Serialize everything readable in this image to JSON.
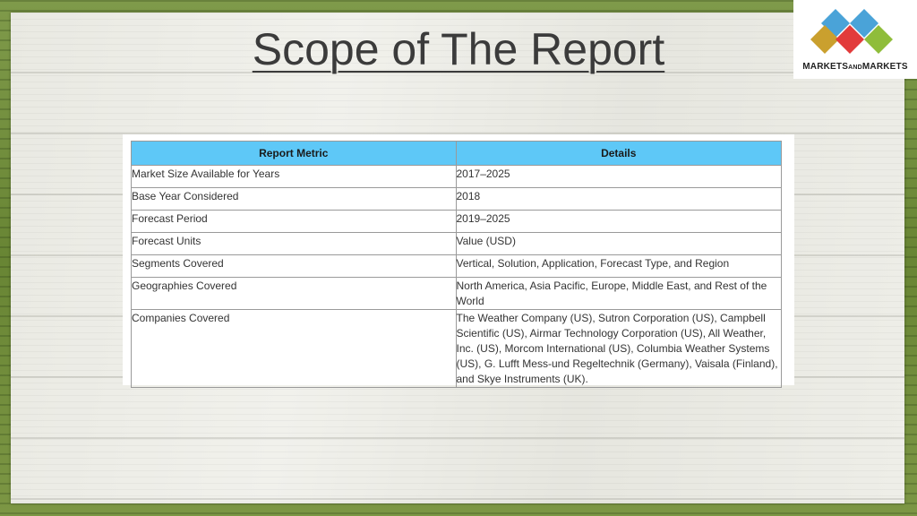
{
  "slide": {
    "title": "Scope of The Report"
  },
  "logo": {
    "text_part1": "MARKETS",
    "text_part2": "AND",
    "text_part3": "MARKETS",
    "colors": [
      "#4aa3d8",
      "#8fbd3a",
      "#e23b3b",
      "#caa02e"
    ]
  },
  "table": {
    "headers": [
      "Report Metric",
      "Details"
    ],
    "header_color": "#5ec8f7",
    "rows": [
      [
        "Market Size Available for Years",
        "2017–2025"
      ],
      [
        "Base Year Considered",
        "2018"
      ],
      [
        "Forecast Period",
        "2019–2025"
      ],
      [
        "Forecast Units",
        "Value (USD)"
      ],
      [
        "Segments Covered",
        "Vertical, Solution, Application, Forecast Type, and Region"
      ],
      [
        "Geographies Covered",
        "North America, Asia Pacific, Europe, Middle East, and Rest of the World"
      ],
      [
        "Companies Covered",
        "The Weather Company (US), Sutron Corporation (US), Campbell Scientific (US), Airmar Technology Corporation (US), All Weather, Inc. (US), Morcom International (US), Columbia Weather Systems (US), G. Lufft Mess-und Regeltechnik (Germany), Vaisala (Finland), and Skye Instruments (UK)."
      ]
    ]
  }
}
